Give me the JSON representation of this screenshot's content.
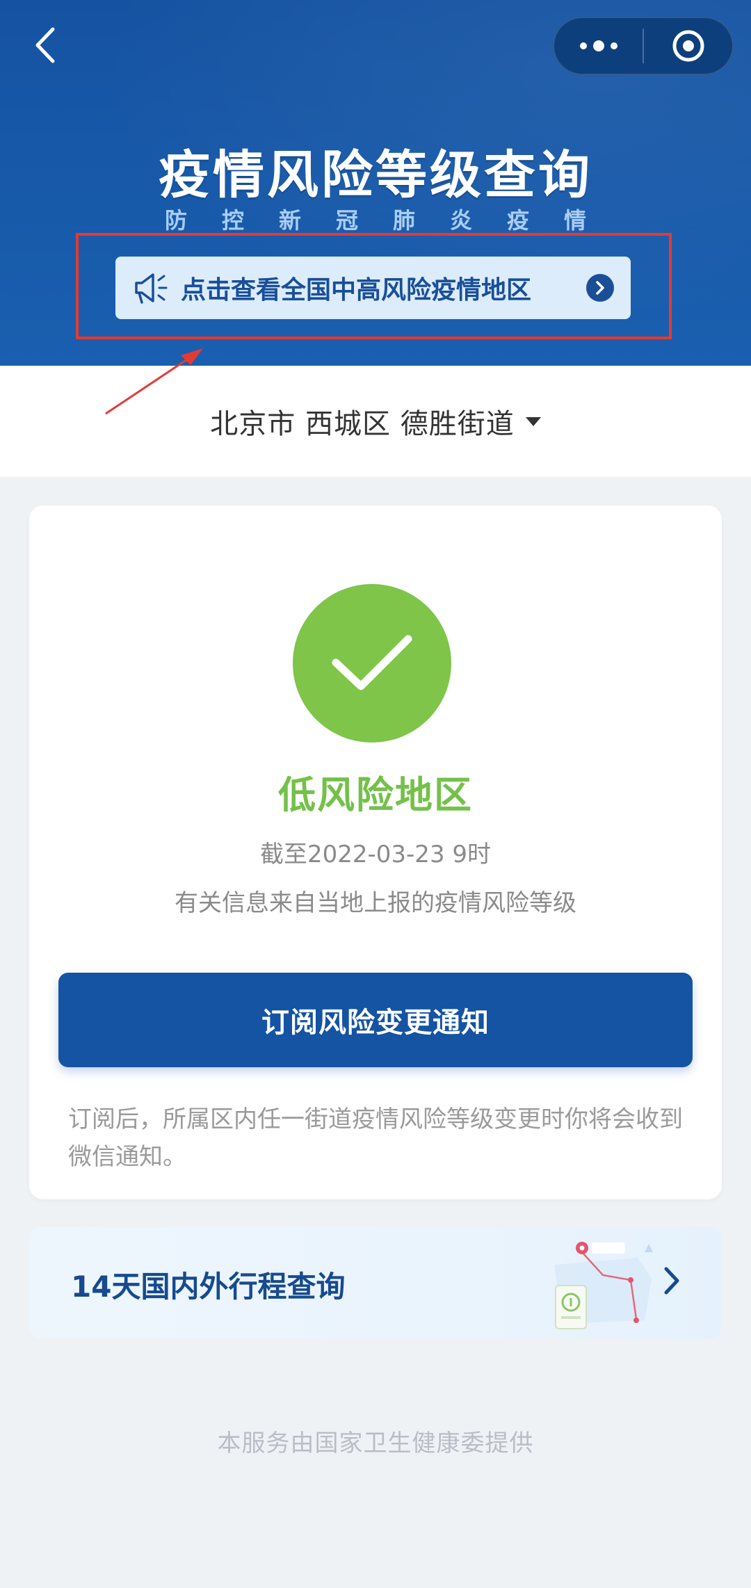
{
  "header": {
    "title": "疫情风险等级查询",
    "subtitle": "防控新冠肺炎疫情",
    "banner_text": "点击查看全国中高风险疫情地区"
  },
  "location": {
    "text": "北京市 西城区 德胜街道"
  },
  "risk": {
    "level": "低风险地区",
    "updated": "截至2022-03-23 9时",
    "source": "有关信息来自当地上报的疫情风险等级",
    "subscribe_label": "订阅风险变更通知",
    "note": "订阅后，所属区内任一街道疫情风险等级变更时你将会收到微信通知。"
  },
  "trip": {
    "label": "14天国内外行程查询"
  },
  "footer": {
    "text": "本服务由国家卫生健康委提供"
  },
  "colors": {
    "header_blue": "#1553a2",
    "low_risk_green": "#7ec54a",
    "button_blue": "#1553a3",
    "annotation_red": "#e53a32"
  },
  "icons": [
    "back-icon",
    "more-icon",
    "close-miniprogram-icon",
    "megaphone-icon",
    "chevron-right-icon",
    "checkmark-icon",
    "dropdown-caret-icon",
    "map-route-illustration"
  ]
}
